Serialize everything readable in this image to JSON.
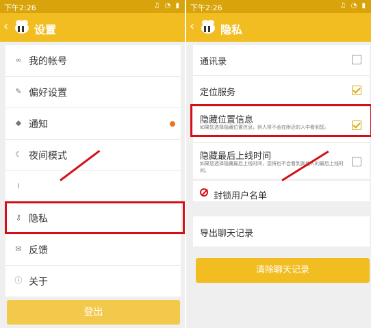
{
  "left": {
    "status": {
      "time": "下午2:26"
    },
    "header": {
      "title": "设置"
    },
    "menu": [
      {
        "label": "我的帐号",
        "icon": "link-icon"
      },
      {
        "label": "偏好设置",
        "icon": "preferences-icon"
      },
      {
        "label": "通知",
        "icon": "bell-icon"
      },
      {
        "label": "夜间模式",
        "icon": "moon-icon"
      },
      {
        "label": "",
        "icon": "info-icon"
      },
      {
        "label": "隐私",
        "icon": "key-icon"
      },
      {
        "label": "反馈",
        "icon": "mail-icon"
      },
      {
        "label": "关于",
        "icon": "info-icon"
      }
    ],
    "logout_label": "登出"
  },
  "right": {
    "status": {
      "time": "下午2:26"
    },
    "header": {
      "title": "隐私"
    },
    "settings": [
      {
        "label": "通讯录",
        "checked": false
      },
      {
        "label": "定位服务",
        "checked": true
      },
      {
        "label": "隐藏位置信息",
        "desc": "如果您选择隐藏位置信息，别人将不会在附近的人中看到您。",
        "checked": true
      },
      {
        "label": "隐藏最后上线时间",
        "desc": "如果您选择隐藏最后上线时间，您将也不会看到其他人的最后上线时间。",
        "checked": false
      }
    ],
    "blocked_label": "封锁用户名单",
    "export_label": "导出聊天记录",
    "clear_label": "清除聊天记录"
  },
  "colors": {
    "accent": "#f1bd21",
    "highlight": "#d40f16"
  }
}
